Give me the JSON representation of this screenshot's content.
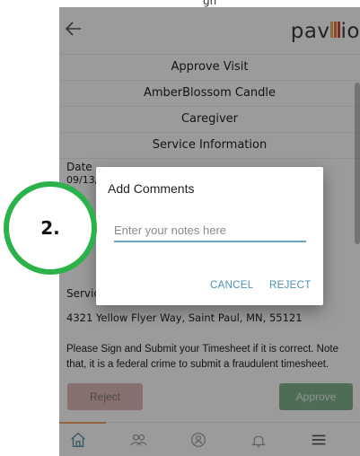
{
  "header": {
    "back_icon": "arrow-left-icon",
    "logo_prefix": "pav",
    "logo_mid": "ill",
    "logo_suffix": "io",
    "logo_bar_colors": [
      "#f0a75a",
      "#e2733a",
      "#c9482a"
    ]
  },
  "top_fragment": "gh",
  "rows": [
    "Approve Visit",
    "AmberBlossom Candle",
    "Caregiver",
    "Service Information"
  ],
  "date_label": "Date",
  "date_value": "09/13/",
  "service_label": "Servic",
  "address": "4321 Yellow Flyer Way, Saint Paul, MN, 55121",
  "notice": "Please Sign and Submit your Timesheet if it is correct. Note that, it is a federal crime to submit a fraudulent timesheet.",
  "actions": {
    "reject": "Reject",
    "approve": "Approve"
  },
  "bottom_tabs": [
    "home-icon",
    "people-icon",
    "id-badge-icon",
    "bell-icon",
    "menu-icon"
  ],
  "dialog": {
    "title": "Add Comments",
    "placeholder": "Enter your notes here",
    "cancel": "CANCEL",
    "reject": "REJECT"
  },
  "step_marker": "2.",
  "colors": {
    "accent": "#6aa7c6",
    "step_ring": "#2bb24b",
    "approve": "#7fae8c",
    "reject": "#d9b6b4"
  }
}
